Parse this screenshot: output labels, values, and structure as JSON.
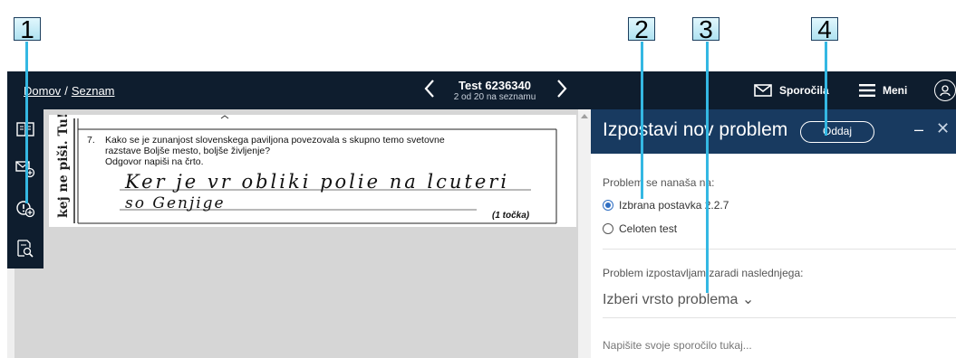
{
  "callouts": [
    "1",
    "2",
    "3",
    "4"
  ],
  "header": {
    "breadcrumb_home": "Domov",
    "breadcrumb_sep": "/",
    "breadcrumb_list": "Seznam",
    "test_title": "Test 6236340",
    "test_subtitle": "2 od 20 na seznamu",
    "messages_label": "Sporočila",
    "menu_label": "Meni"
  },
  "icons": {
    "prev": "chevron-left-icon",
    "next": "chevron-right-icon",
    "messages": "envelope-icon",
    "menu": "hamburger-icon",
    "user": "user-icon",
    "rail": [
      "book-icon",
      "add-comment-icon",
      "report-problem-icon",
      "zoom-document-icon"
    ]
  },
  "scan": {
    "margin_text": "kej ne piši. Tu!",
    "question_number": "7.",
    "question_line1": "Kako se je zunanjost slovenskega paviljona povezovala s skupno temo svetovne",
    "question_line2": "razstave Boljše mesto, boljše življenje?",
    "question_line3": "Odgovor napiši na črto.",
    "answer_line1": "Ker je vr obliki polie na lcuteri",
    "answer_line2": "so Genjige",
    "points": "(1 točka)"
  },
  "panel": {
    "title": "Izpostavi nov problem",
    "submit_label": "Oddaj",
    "minimize": "–",
    "close": "✕",
    "relates_label": "Problem se nanaša na:",
    "option_item": "Izbrana postavka 2.2.7",
    "option_test": "Celoten test",
    "reason_label": "Problem izpostavljam zaradi naslednjega:",
    "type_select": "Izberi vrsto problema ⌄",
    "message_placeholder": "Napišite svoje sporočilo tukaj..."
  },
  "colors": {
    "topbar": "#0e1d2e",
    "panel_header": "#183a60",
    "callout_line": "#34b8e3"
  }
}
